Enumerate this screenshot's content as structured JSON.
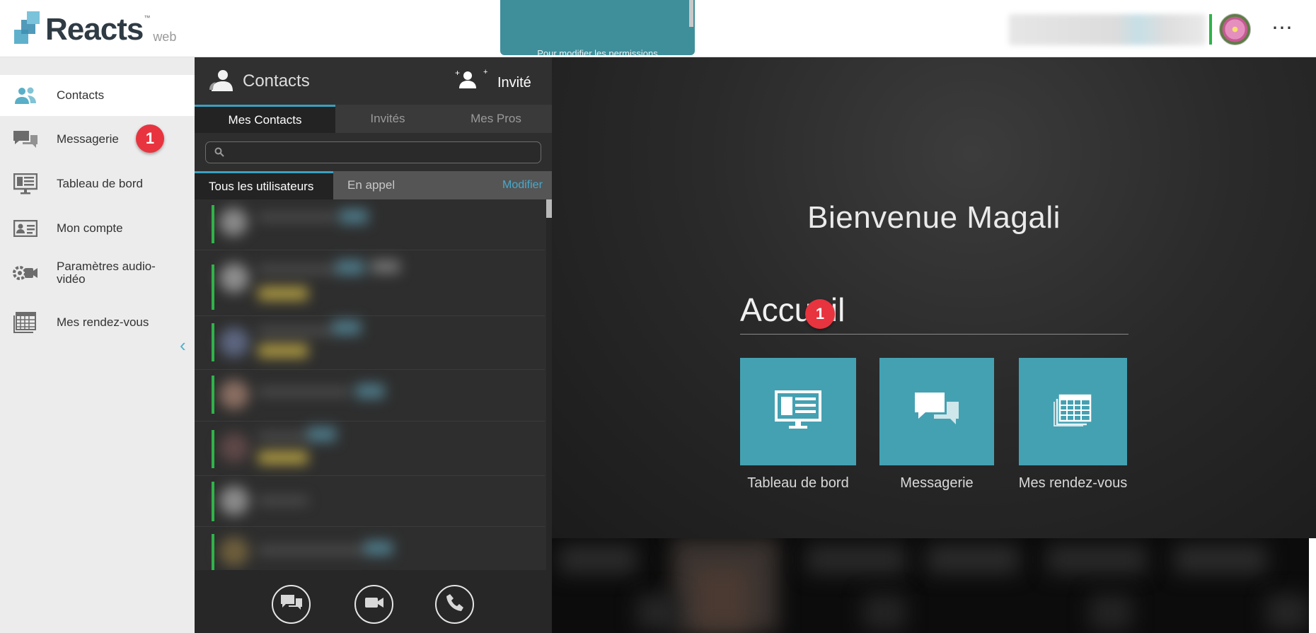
{
  "header": {
    "brand": "Reacts",
    "brand_tm": "™",
    "brand_sub": "web",
    "notice": "Pour modifier les permissions"
  },
  "sidebar": {
    "items": [
      {
        "label": "Contacts",
        "icon": "contacts-icon",
        "active": true
      },
      {
        "label": "Messagerie",
        "icon": "chat-icon",
        "badge": "1"
      },
      {
        "label": "Tableau de bord",
        "icon": "dashboard-icon"
      },
      {
        "label": "Mon compte",
        "icon": "id-card-icon"
      },
      {
        "label": "Paramètres audio-vidéo",
        "icon": "av-settings-icon"
      },
      {
        "label": "Mes rendez-vous",
        "icon": "calendar-icon"
      }
    ]
  },
  "contacts": {
    "title": "Contacts",
    "invite": "Invité",
    "tabs": [
      "Mes Contacts",
      "Invités",
      "Mes Pros"
    ],
    "search": {
      "value": "",
      "placeholder": ""
    },
    "subtabs": [
      "Tous les utilisateurs",
      "En appel"
    ],
    "modify": "Modifier"
  },
  "main": {
    "welcome": "Bienvenue Magali",
    "section": "Accueil",
    "tiles": [
      {
        "label": "Tableau de bord",
        "icon": "dashboard-icon"
      },
      {
        "label": "Messagerie",
        "icon": "chat-icon",
        "badge": "1"
      },
      {
        "label": "Mes rendez-vous",
        "icon": "calendar-icon"
      }
    ]
  },
  "colors": {
    "accent": "#44a1b2",
    "badge": "#e8343f",
    "presence": "#2fb34a",
    "link": "#48a9cc"
  }
}
